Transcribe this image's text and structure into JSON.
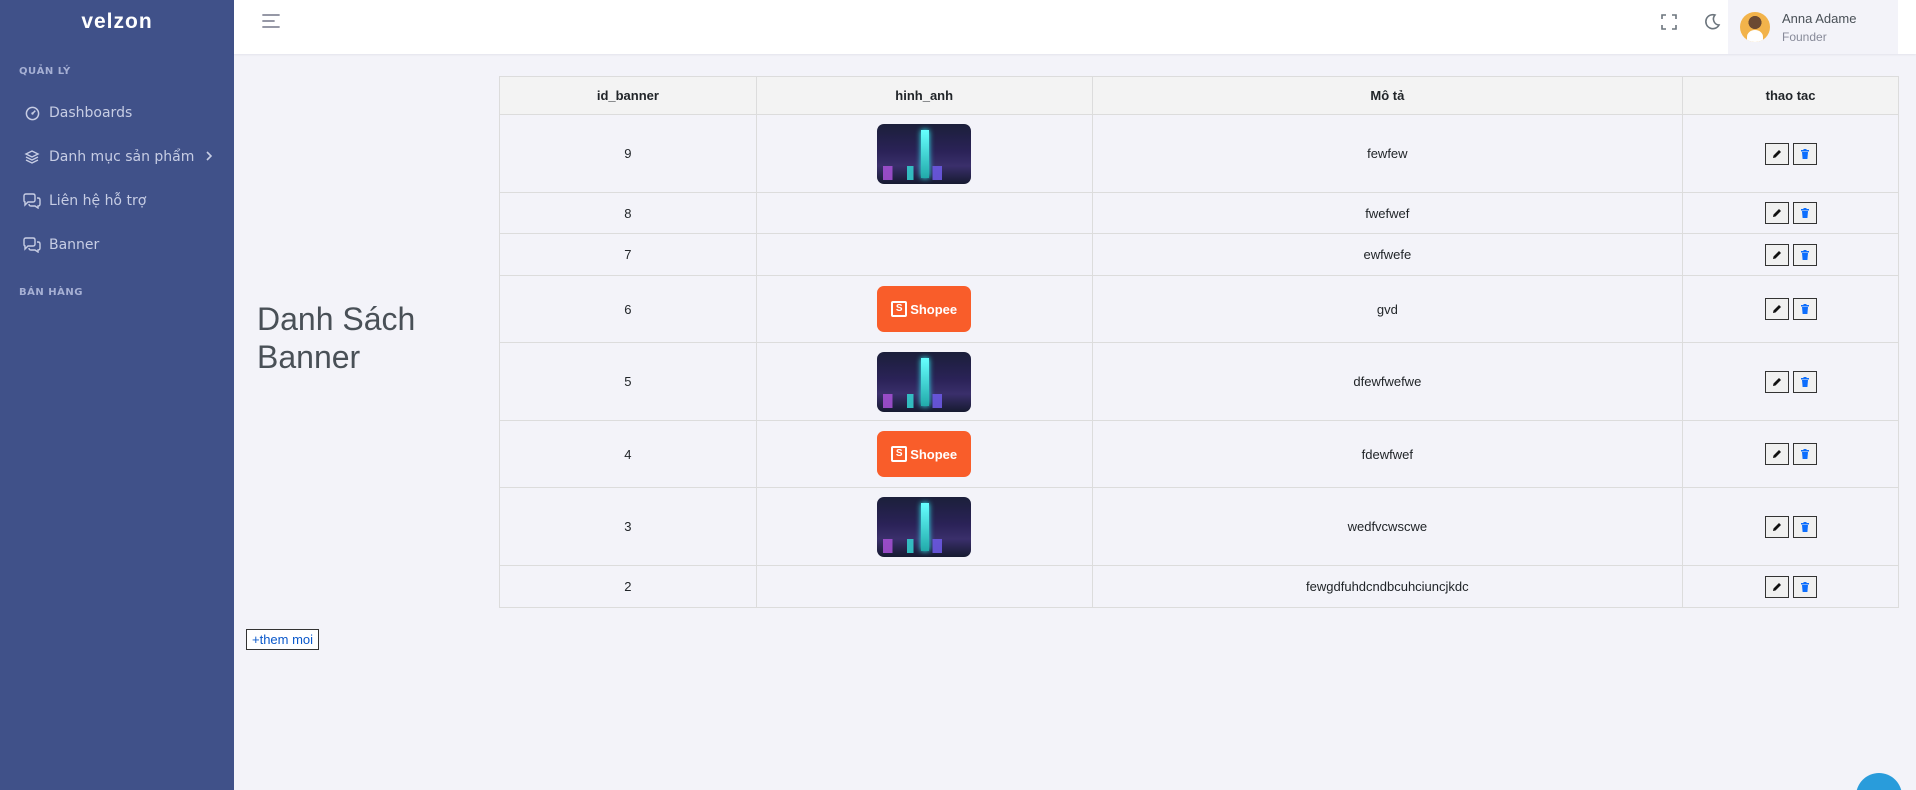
{
  "app": {
    "logo": "velzon"
  },
  "sidebar": {
    "section_manage": "QUẢN LÝ",
    "section_sales": "BÁN HÀNG",
    "items": [
      {
        "label": "Dashboards",
        "icon": "dashboard-icon"
      },
      {
        "label": "Danh mục sản phẩm",
        "icon": "layers-icon",
        "has_submenu": true
      },
      {
        "label": "Liên hệ hỗ trợ",
        "icon": "chat-icon"
      },
      {
        "label": "Banner",
        "icon": "chat-icon"
      }
    ]
  },
  "header": {
    "user_name": "Anna Adame",
    "user_role": "Founder"
  },
  "page": {
    "title": "Danh Sách Banner",
    "add_button": "+them moi"
  },
  "table": {
    "columns": [
      "id_banner",
      "hinh_anh",
      "Mô tả",
      "thao tac"
    ],
    "rows": [
      {
        "id": "9",
        "image": "city",
        "description": "fewfew"
      },
      {
        "id": "8",
        "image": "",
        "description": "fwefwef"
      },
      {
        "id": "7",
        "image": "",
        "description": "ewfwefe"
      },
      {
        "id": "6",
        "image": "shopee",
        "description": "gvd"
      },
      {
        "id": "5",
        "image": "city",
        "description": "dfewfwefwe"
      },
      {
        "id": "4",
        "image": "shopee",
        "description": "fdewfwef"
      },
      {
        "id": "3",
        "image": "city",
        "description": "wedfvcwscwe"
      },
      {
        "id": "2",
        "image": "",
        "description": "fewgdfuhdcndbcuhciuncjkdc"
      }
    ],
    "shopee_text": "Shopee"
  },
  "colors": {
    "sidebar_bg": "#405189",
    "page_bg": "#f3f3f9",
    "shopee": "#f95d2a",
    "delete_icon": "#0d6efd"
  }
}
